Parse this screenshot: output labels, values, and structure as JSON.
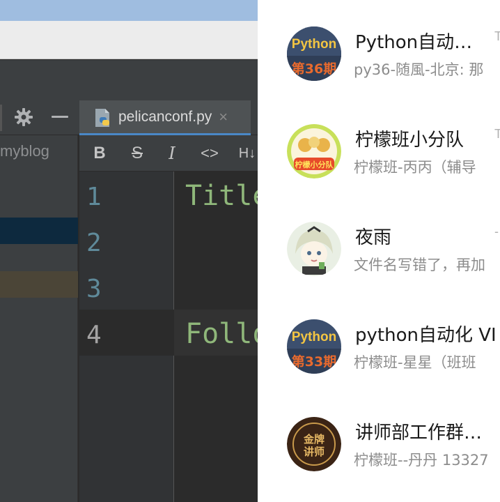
{
  "ide": {
    "tab_label": "pelicanconf.py",
    "tab_close": "×",
    "project_label": "myblog",
    "toolbar": {
      "bold": "B",
      "strike": "S",
      "italic": "I",
      "code": "<>",
      "heading": "H↓"
    },
    "line_numbers": [
      "1",
      "2",
      "3",
      "4"
    ],
    "code_lines": {
      "line1": "Title",
      "line4": "Follo"
    }
  },
  "chats": [
    {
      "title": "Python自动…",
      "subtitle": "py36-随風-北京: 那",
      "time": "T",
      "avatar": {
        "top": "Python",
        "bottom": "第36期",
        "bg": "#3c4f6e"
      }
    },
    {
      "title": "柠檬班小分队",
      "subtitle": "柠檬班-丙丙（辅导",
      "time": "T",
      "avatar": {
        "text": "柠檬小分队",
        "bg": "#c8e05a"
      }
    },
    {
      "title": "夜雨",
      "subtitle": "文件名写错了，再加",
      "time": "-",
      "avatar": {
        "bg": "#e9efe4"
      }
    },
    {
      "title": "python自动化 VI",
      "subtitle": "柠檬班-星星（班班",
      "time": "",
      "avatar": {
        "top": "Python",
        "bottom": "第33期",
        "bg": "#3c4f6e"
      }
    },
    {
      "title": "讲师部工作群…",
      "subtitle": "柠檬班--丹丹 13327",
      "time": "",
      "avatar": {
        "text": "金牌讲师",
        "bg": "#3b2415"
      }
    }
  ],
  "colors": {
    "ide_bg": "#2b2b2b",
    "code_green": "#8fb77a",
    "chat_bg": "#ffffff",
    "accent_tab": "#4a88c7"
  }
}
